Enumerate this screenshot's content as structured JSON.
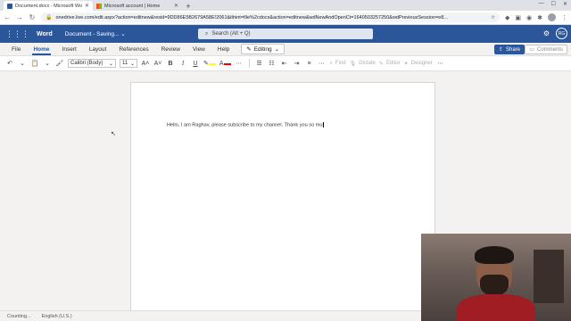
{
  "browser": {
    "tabs": [
      {
        "title": "Document.docx - Microsoft Wor...",
        "active": true
      },
      {
        "title": "Microsoft account | Home",
        "active": false
      }
    ],
    "url": "onedrive.live.com/edit.aspx?action=editnew&resid=9DD86E5B2679A58E!2061&ithint=file%2cdocx&action=editnew&wdNewAndOpenCt=1640503257250&wdPreviousSession=e8..."
  },
  "word": {
    "app_name": "Word",
    "doc_status": "Document - Saving...",
    "search_placeholder": "Search (Alt + Q)",
    "menu": [
      "File",
      "Home",
      "Insert",
      "Layout",
      "References",
      "Review",
      "View",
      "Help"
    ],
    "active_menu": "Home",
    "editing_label": "Editing",
    "share_label": "Share",
    "comments_label": "Comments",
    "ribbon": {
      "font": "Calibri (Body)",
      "size": "11",
      "find_label": "Find",
      "dictate_label": "Dictate",
      "editor_label": "Editor",
      "designer_label": "Designer"
    },
    "account_initials": "RG"
  },
  "document": {
    "text": "Hello, I am Raghav, please subscribe to my channel. Thank you so mu"
  },
  "status": {
    "counting": "Counting...",
    "language": "English (U.S.)"
  }
}
